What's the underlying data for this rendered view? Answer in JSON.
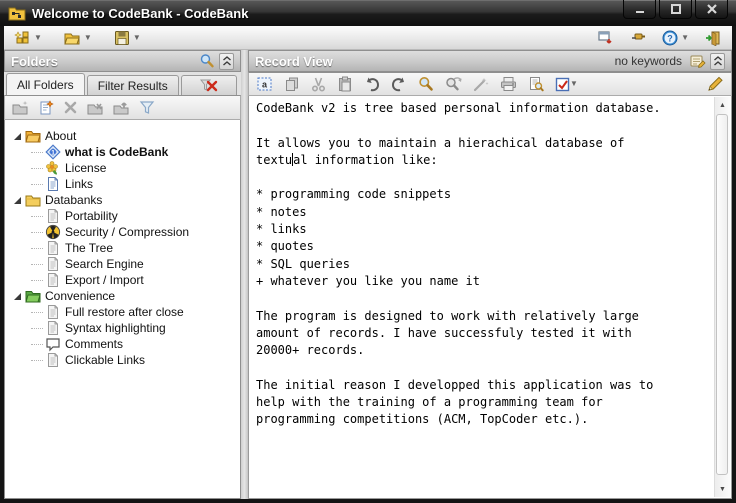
{
  "window": {
    "title": "Welcome to CodeBank - CodeBank",
    "controls": [
      "minimize",
      "maximize",
      "close"
    ]
  },
  "main_toolbar": {
    "left": [
      {
        "name": "new",
        "dropdown": true
      },
      {
        "name": "open",
        "dropdown": true
      },
      {
        "name": "save",
        "dropdown": true
      }
    ],
    "right": [
      {
        "name": "detach-window",
        "dropdown": false
      },
      {
        "name": "pin",
        "dropdown": false
      },
      {
        "name": "help",
        "dropdown": true
      },
      {
        "name": "exit",
        "dropdown": false
      }
    ]
  },
  "folders_panel": {
    "title": "Folders",
    "header_icons": [
      "search",
      "collapse"
    ],
    "tabs": [
      {
        "label": "All Folders",
        "active": true
      },
      {
        "label": "Filter Results",
        "active": false
      },
      {
        "label": "",
        "icon": "clear-filter",
        "active": false
      }
    ],
    "toolbar": [
      "new-folder",
      "new-record-item",
      "delete",
      "cut-record",
      "paste-record",
      "filter"
    ],
    "tree": [
      {
        "label": "About",
        "icon": "folder-open-orange",
        "level": 0,
        "expander": true
      },
      {
        "label": "what is CodeBank",
        "icon": "record-diamond",
        "level": 1,
        "selected": true
      },
      {
        "label": "License",
        "icon": "flower",
        "level": 1
      },
      {
        "label": "Links",
        "icon": "document-blue",
        "level": 1
      },
      {
        "label": "Databanks",
        "icon": "folder-yellow",
        "level": 0,
        "expander": true
      },
      {
        "label": "Portability",
        "icon": "document",
        "level": 1
      },
      {
        "label": "Security / Compression",
        "icon": "radiation",
        "level": 1
      },
      {
        "label": "The Tree",
        "icon": "document",
        "level": 1
      },
      {
        "label": "Search Engine",
        "icon": "document",
        "level": 1
      },
      {
        "label": "Export / Import",
        "icon": "document",
        "level": 1
      },
      {
        "label": "Convenience",
        "icon": "folder-open-green",
        "level": 0,
        "expander": true
      },
      {
        "label": "Full restore after close",
        "icon": "document",
        "level": 1
      },
      {
        "label": "Syntax highlighting",
        "icon": "document",
        "level": 1
      },
      {
        "label": "Comments",
        "icon": "comment-bubble",
        "level": 1
      },
      {
        "label": "Clickable Links",
        "icon": "document",
        "level": 1
      }
    ]
  },
  "record_panel": {
    "title": "Record View",
    "status": "no keywords",
    "header_icons": [
      "keywords",
      "collapse"
    ],
    "toolbar": [
      {
        "name": "select-all"
      },
      {
        "name": "copy"
      },
      {
        "name": "cut"
      },
      {
        "name": "paste"
      },
      {
        "name": "undo"
      },
      {
        "name": "redo"
      },
      {
        "name": "find"
      },
      {
        "name": "find-next"
      },
      {
        "name": "replace"
      },
      {
        "name": "print"
      },
      {
        "name": "print-preview"
      },
      {
        "name": "checkbox",
        "dropdown": true
      }
    ],
    "edit_tool": "pencil",
    "caret": {
      "line": 3,
      "col": 5
    },
    "content_lines": [
      "CodeBank v2 is tree based personal information database.",
      "",
      "It allows you to maintain a hierachical database of",
      "textual information like:",
      "",
      "* programming code snippets",
      "* notes",
      "* links",
      "* quotes",
      "* SQL queries",
      "+ whatever you like you name it",
      "",
      "The program is designed to work with relatively large",
      "amount of records. I have successfuly tested it with",
      "20000+ records.",
      "",
      "The initial reason I developped this application was to",
      "help with the training of a programming team for",
      "programming competitions (ACM, TopCoder etc.)."
    ]
  }
}
